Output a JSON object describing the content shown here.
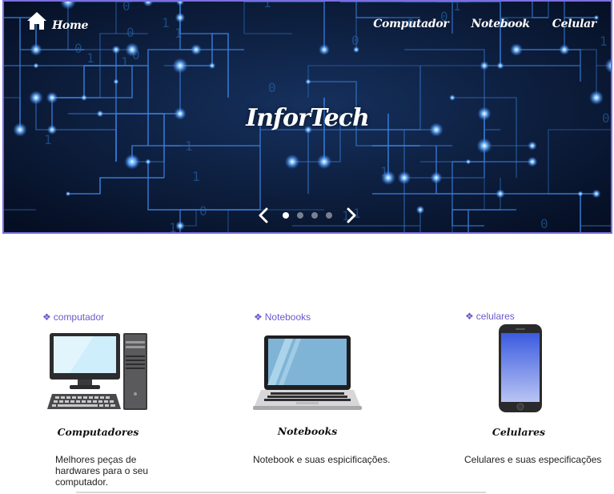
{
  "nav": {
    "home_label": "Home",
    "links": [
      "Computador",
      "Notebook",
      "Celular"
    ]
  },
  "hero": {
    "title": "InforTech",
    "slides": 4,
    "active_slide": 1
  },
  "cards": [
    {
      "tag": "computador",
      "title": "Computadores",
      "description": "Melhores peças de hardwares para o seu computador."
    },
    {
      "tag": "Notebooks",
      "title": "Notebooks",
      "description": "Notebook e suas espicificações."
    },
    {
      "tag": "celulares",
      "title": "Celulares",
      "description": "Celulares e suas especificações"
    }
  ],
  "colors": {
    "hero_border": "#7b6ee0",
    "tag_accent": "#6a5acd",
    "circuit_glow": "#4aa8ff"
  },
  "icons": {
    "home": "home-icon",
    "prev": "chevron-left-icon",
    "next": "chevron-right-icon",
    "tag_bullet": "diamond-cluster-icon"
  }
}
